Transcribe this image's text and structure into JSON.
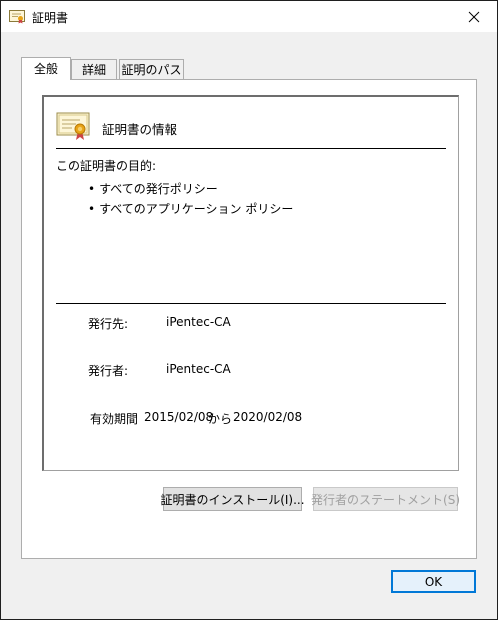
{
  "window": {
    "title": "証明書",
    "close_glyph": "✕"
  },
  "tabs": [
    {
      "label": "全般",
      "active": true
    },
    {
      "label": "詳細",
      "active": false
    },
    {
      "label": "証明のパス",
      "active": false
    }
  ],
  "general": {
    "heading": "証明書の情報",
    "purpose_title": "この証明書の目的:",
    "purposes": [
      "すべての発行ポリシー",
      "すべてのアプリケーション ポリシー"
    ],
    "issued_to_label": "発行先:",
    "issued_to_value": "iPentec-CA",
    "issued_by_label": "発行者:",
    "issued_by_value": "iPentec-CA",
    "validity_label": "有効期間",
    "valid_from": "2015/02/08",
    "validity_separator": "から",
    "valid_to": "2020/02/08"
  },
  "buttons": {
    "install": "証明書のインストール(I)...",
    "issuer_statement": "発行者のステートメント(S)",
    "ok": "OK"
  },
  "icons": {
    "title_icon": "certificate-icon",
    "cert_icon": "certificate-ribbon-icon"
  },
  "colors": {
    "accent": "#0078d7",
    "ribbon": "#e8a317"
  }
}
